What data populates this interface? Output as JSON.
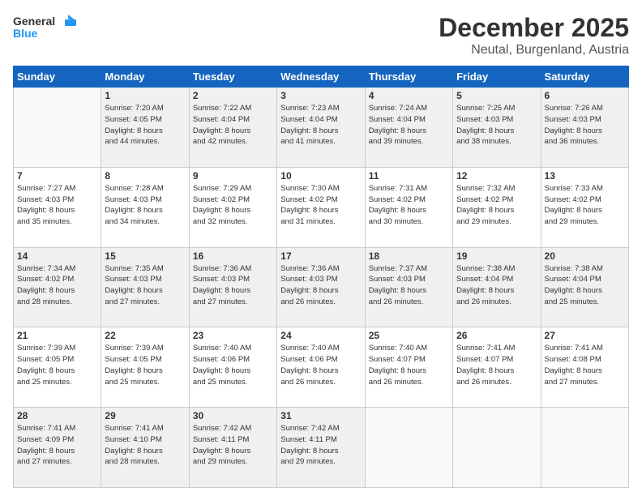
{
  "header": {
    "logo_general": "General",
    "logo_blue": "Blue",
    "month_year": "December 2025",
    "location": "Neutal, Burgenland, Austria"
  },
  "weekdays": [
    "Sunday",
    "Monday",
    "Tuesday",
    "Wednesday",
    "Thursday",
    "Friday",
    "Saturday"
  ],
  "weeks": [
    [
      {
        "day": "",
        "info": ""
      },
      {
        "day": "1",
        "info": "Sunrise: 7:20 AM\nSunset: 4:05 PM\nDaylight: 8 hours\nand 44 minutes."
      },
      {
        "day": "2",
        "info": "Sunrise: 7:22 AM\nSunset: 4:04 PM\nDaylight: 8 hours\nand 42 minutes."
      },
      {
        "day": "3",
        "info": "Sunrise: 7:23 AM\nSunset: 4:04 PM\nDaylight: 8 hours\nand 41 minutes."
      },
      {
        "day": "4",
        "info": "Sunrise: 7:24 AM\nSunset: 4:04 PM\nDaylight: 8 hours\nand 39 minutes."
      },
      {
        "day": "5",
        "info": "Sunrise: 7:25 AM\nSunset: 4:03 PM\nDaylight: 8 hours\nand 38 minutes."
      },
      {
        "day": "6",
        "info": "Sunrise: 7:26 AM\nSunset: 4:03 PM\nDaylight: 8 hours\nand 36 minutes."
      }
    ],
    [
      {
        "day": "7",
        "info": "Sunrise: 7:27 AM\nSunset: 4:03 PM\nDaylight: 8 hours\nand 35 minutes."
      },
      {
        "day": "8",
        "info": "Sunrise: 7:28 AM\nSunset: 4:03 PM\nDaylight: 8 hours\nand 34 minutes."
      },
      {
        "day": "9",
        "info": "Sunrise: 7:29 AM\nSunset: 4:02 PM\nDaylight: 8 hours\nand 32 minutes."
      },
      {
        "day": "10",
        "info": "Sunrise: 7:30 AM\nSunset: 4:02 PM\nDaylight: 8 hours\nand 31 minutes."
      },
      {
        "day": "11",
        "info": "Sunrise: 7:31 AM\nSunset: 4:02 PM\nDaylight: 8 hours\nand 30 minutes."
      },
      {
        "day": "12",
        "info": "Sunrise: 7:32 AM\nSunset: 4:02 PM\nDaylight: 8 hours\nand 29 minutes."
      },
      {
        "day": "13",
        "info": "Sunrise: 7:33 AM\nSunset: 4:02 PM\nDaylight: 8 hours\nand 29 minutes."
      }
    ],
    [
      {
        "day": "14",
        "info": "Sunrise: 7:34 AM\nSunset: 4:02 PM\nDaylight: 8 hours\nand 28 minutes."
      },
      {
        "day": "15",
        "info": "Sunrise: 7:35 AM\nSunset: 4:03 PM\nDaylight: 8 hours\nand 27 minutes."
      },
      {
        "day": "16",
        "info": "Sunrise: 7:36 AM\nSunset: 4:03 PM\nDaylight: 8 hours\nand 27 minutes."
      },
      {
        "day": "17",
        "info": "Sunrise: 7:36 AM\nSunset: 4:03 PM\nDaylight: 8 hours\nand 26 minutes."
      },
      {
        "day": "18",
        "info": "Sunrise: 7:37 AM\nSunset: 4:03 PM\nDaylight: 8 hours\nand 26 minutes."
      },
      {
        "day": "19",
        "info": "Sunrise: 7:38 AM\nSunset: 4:04 PM\nDaylight: 8 hours\nand 26 minutes."
      },
      {
        "day": "20",
        "info": "Sunrise: 7:38 AM\nSunset: 4:04 PM\nDaylight: 8 hours\nand 25 minutes."
      }
    ],
    [
      {
        "day": "21",
        "info": "Sunrise: 7:39 AM\nSunset: 4:05 PM\nDaylight: 8 hours\nand 25 minutes."
      },
      {
        "day": "22",
        "info": "Sunrise: 7:39 AM\nSunset: 4:05 PM\nDaylight: 8 hours\nand 25 minutes."
      },
      {
        "day": "23",
        "info": "Sunrise: 7:40 AM\nSunset: 4:06 PM\nDaylight: 8 hours\nand 25 minutes."
      },
      {
        "day": "24",
        "info": "Sunrise: 7:40 AM\nSunset: 4:06 PM\nDaylight: 8 hours\nand 26 minutes."
      },
      {
        "day": "25",
        "info": "Sunrise: 7:40 AM\nSunset: 4:07 PM\nDaylight: 8 hours\nand 26 minutes."
      },
      {
        "day": "26",
        "info": "Sunrise: 7:41 AM\nSunset: 4:07 PM\nDaylight: 8 hours\nand 26 minutes."
      },
      {
        "day": "27",
        "info": "Sunrise: 7:41 AM\nSunset: 4:08 PM\nDaylight: 8 hours\nand 27 minutes."
      }
    ],
    [
      {
        "day": "28",
        "info": "Sunrise: 7:41 AM\nSunset: 4:09 PM\nDaylight: 8 hours\nand 27 minutes."
      },
      {
        "day": "29",
        "info": "Sunrise: 7:41 AM\nSunset: 4:10 PM\nDaylight: 8 hours\nand 28 minutes."
      },
      {
        "day": "30",
        "info": "Sunrise: 7:42 AM\nSunset: 4:11 PM\nDaylight: 8 hours\nand 29 minutes."
      },
      {
        "day": "31",
        "info": "Sunrise: 7:42 AM\nSunset: 4:11 PM\nDaylight: 8 hours\nand 29 minutes."
      },
      {
        "day": "",
        "info": ""
      },
      {
        "day": "",
        "info": ""
      },
      {
        "day": "",
        "info": ""
      }
    ]
  ]
}
